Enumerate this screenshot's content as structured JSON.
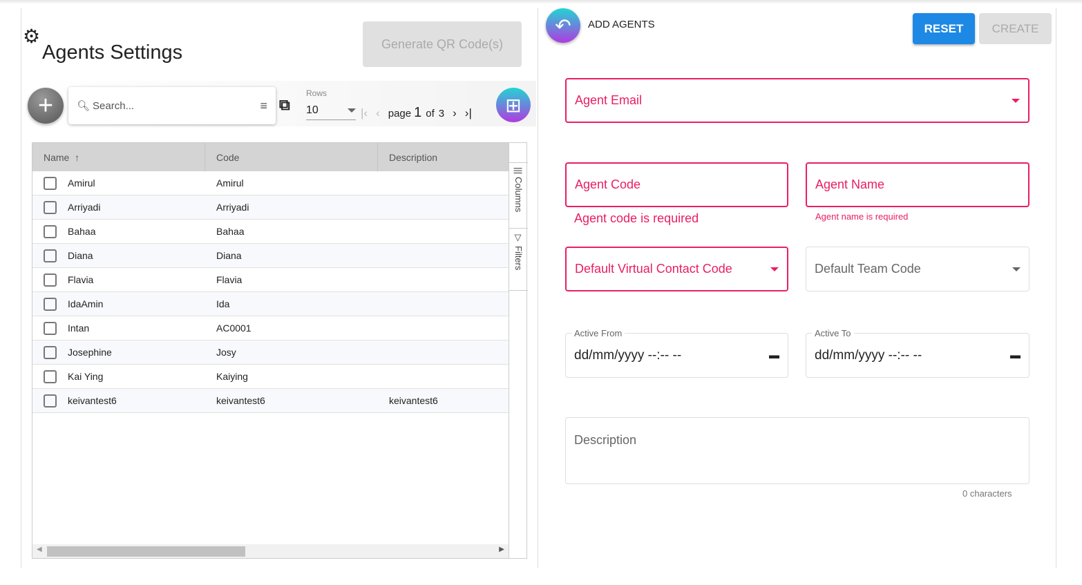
{
  "left": {
    "title": "Agents Settings",
    "qr_button": "Generate QR Code(s)",
    "search_placeholder": "Search...",
    "rows_label": "Rows",
    "rows_value": "10",
    "page_label": "page",
    "page_current": "1",
    "page_of": "of",
    "page_total": "3",
    "columns": [
      "Name",
      "Code",
      "Description"
    ],
    "rows": [
      [
        "Amirul",
        "Amirul",
        ""
      ],
      [
        "Arriyadi",
        "Arriyadi",
        ""
      ],
      [
        "Bahaa",
        "Bahaa",
        ""
      ],
      [
        "Diana",
        "Diana",
        ""
      ],
      [
        "Flavia",
        "Flavia",
        ""
      ],
      [
        "IdaAmin",
        "Ida",
        ""
      ],
      [
        "Intan",
        "AC0001",
        ""
      ],
      [
        "Josephine",
        "Josy",
        ""
      ],
      [
        "Kai Ying",
        "Kaiying",
        ""
      ],
      [
        "keivantest6",
        "keivantest6",
        "keivantest6"
      ]
    ],
    "side_columns": "Columns",
    "side_filters": "Filters"
  },
  "right": {
    "title": "ADD AGENTS",
    "reset": "RESET",
    "create": "CREATE",
    "agent_email": "Agent Email",
    "agent_code": "Agent Code",
    "agent_name": "Agent Name",
    "agent_code_error": "Agent code is required",
    "agent_name_error": "Agent name is required",
    "default_vcc": "Default Virtual Contact Code",
    "default_team": "Default Team Code",
    "active_from_label": "Active From",
    "active_to_label": "Active To",
    "date_placeholder": "dd/mm/yyyy --:-- --",
    "description": "Description",
    "char_count": "0 characters"
  },
  "colors": {
    "accent": "#e91e63",
    "reset": "#1e88e5"
  }
}
